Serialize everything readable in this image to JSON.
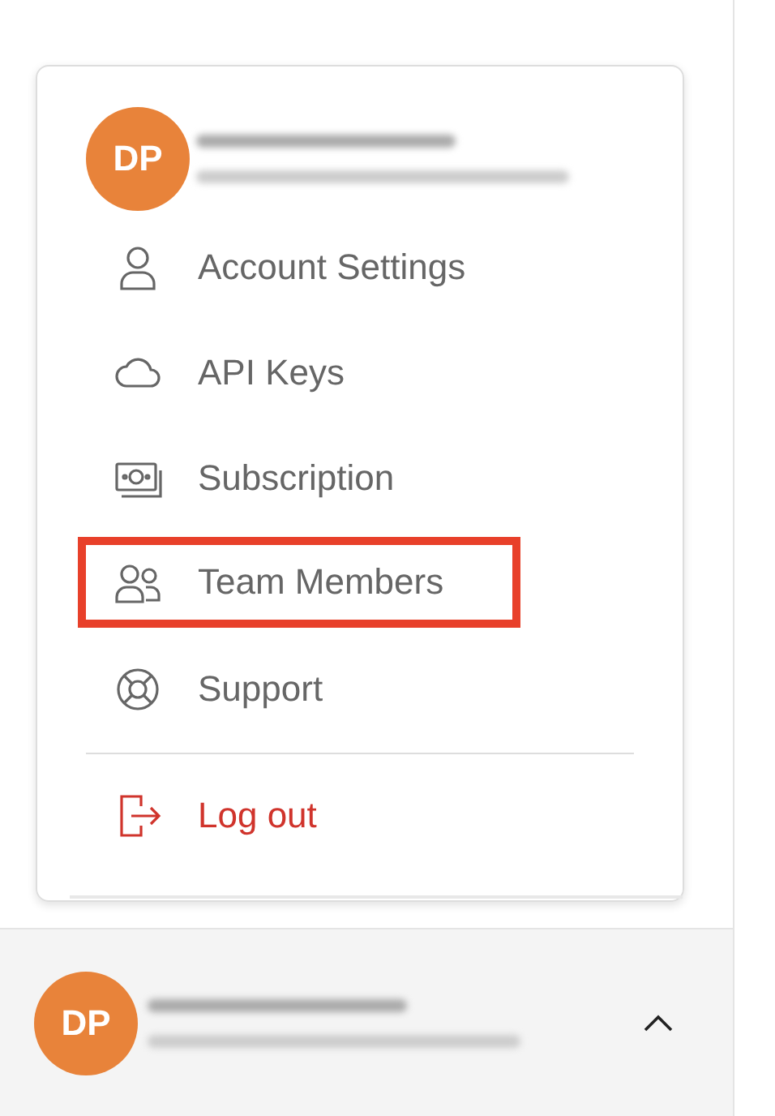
{
  "menu": {
    "avatar": "DP",
    "items": [
      {
        "kind": "account",
        "label": "Account Settings",
        "highlighted": false
      },
      {
        "kind": "key",
        "label": "API Keys",
        "highlighted": false
      },
      {
        "kind": "subscription",
        "label": "Subscription",
        "highlighted": false
      },
      {
        "kind": "team",
        "label": "Team Members",
        "highlighted": true
      },
      {
        "kind": "support",
        "label": "Support",
        "highlighted": false
      }
    ],
    "logout": "Log out"
  },
  "footer": {
    "avatar": "DP"
  }
}
